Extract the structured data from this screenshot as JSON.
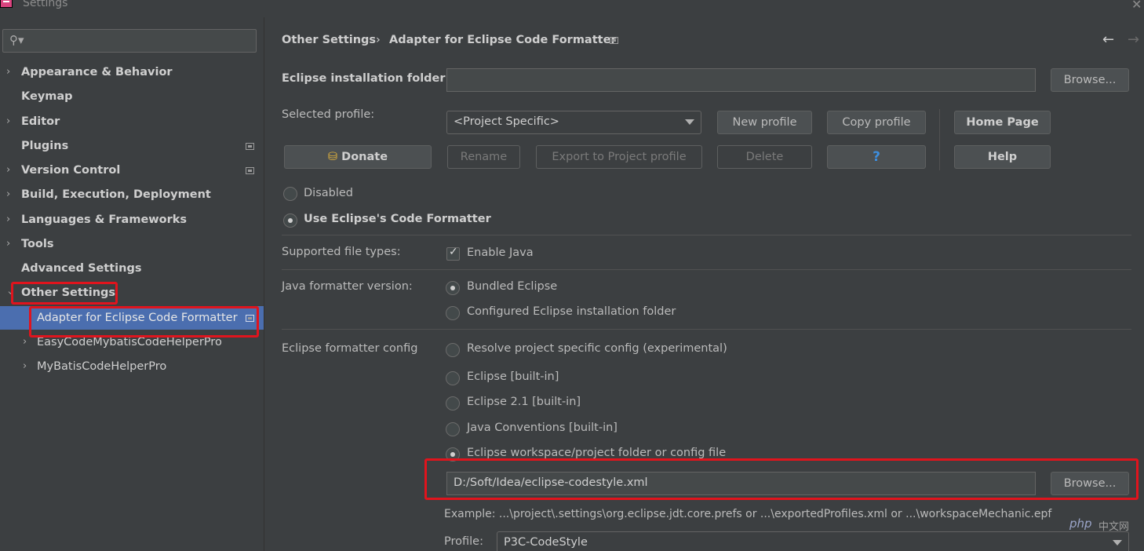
{
  "window": {
    "title": "Settings"
  },
  "sidebar": {
    "search_placeholder": "",
    "items": [
      {
        "label": "Appearance & Behavior"
      },
      {
        "label": "Keymap"
      },
      {
        "label": "Editor"
      },
      {
        "label": "Plugins"
      },
      {
        "label": "Version Control"
      },
      {
        "label": "Build, Execution, Deployment"
      },
      {
        "label": "Languages & Frameworks"
      },
      {
        "label": "Tools"
      },
      {
        "label": "Advanced Settings"
      },
      {
        "label": "Other Settings"
      },
      {
        "label": "Adapter for Eclipse Code Formatter"
      },
      {
        "label": "EasyCodeMybatisCodeHelperPro"
      },
      {
        "label": "MyBatisCodeHelperPro"
      }
    ]
  },
  "breadcrumb": {
    "parent": "Other Settings",
    "separator": "›",
    "current": "Adapter for Eclipse Code Formatter"
  },
  "main": {
    "eclipse_folder_label": "Eclipse installation folder",
    "eclipse_folder_value": "",
    "browse_label": "Browse...",
    "selected_profile_label": "Selected profile:",
    "selected_profile_value": "<Project Specific>",
    "new_profile": "New profile",
    "copy_profile": "Copy profile",
    "home_page": "Home Page",
    "donate": "Donate",
    "rename": "Rename",
    "export_profile": "Export to Project profile",
    "delete": "Delete",
    "question": "?",
    "help": "Help",
    "disabled": "Disabled",
    "use_eclipse": "Use Eclipse's Code Formatter",
    "supported_types_label": "Supported file types:",
    "enable_java": "Enable Java",
    "formatter_version_label": "Java formatter version:",
    "bundled_eclipse": "Bundled Eclipse",
    "configured_eclipse": "Configured Eclipse installation folder",
    "formatter_config_label": "Eclipse formatter config",
    "resolve_specific": "Resolve project specific config (experimental)",
    "eclipse_builtin": "Eclipse [built-in]",
    "eclipse21_builtin": "Eclipse 2.1 [built-in]",
    "java_conventions": "Java Conventions [built-in]",
    "workspace_config": "Eclipse workspace/project folder or config file",
    "config_path": "D:/Soft/Idea/eclipse-codestyle.xml",
    "browse2_label": "Browse...",
    "example": "Example: ...\\project\\.settings\\org.eclipse.jdt.core.prefs or ...\\exportedProfiles.xml or ...\\workspaceMechanic.epf",
    "profile_label": "Profile:",
    "profile_value": "P3C-CodeStyle"
  },
  "watermark": {
    "brand": "php",
    "suffix": "中文网"
  },
  "colors": {
    "selection": "#4b6eaf",
    "highlight_box": "#e0141d",
    "background": "#3c3f41"
  }
}
